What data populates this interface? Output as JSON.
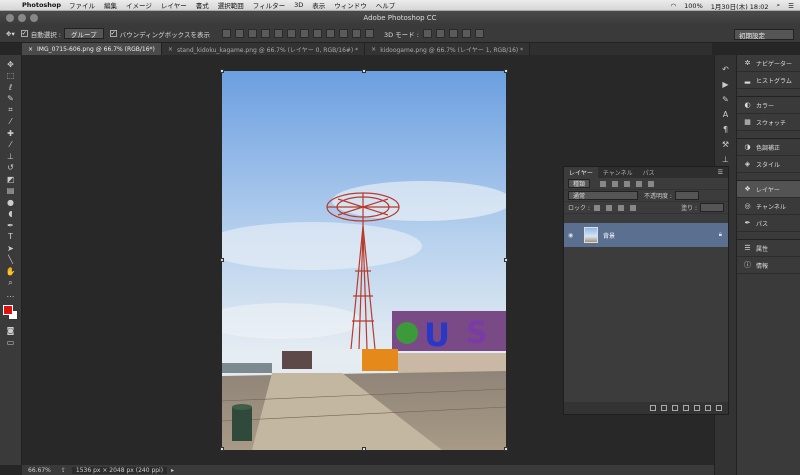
{
  "menubar": {
    "app_name": "Photoshop",
    "items": [
      "ファイル",
      "編集",
      "イメージ",
      "レイヤー",
      "書式",
      "選択範囲",
      "フィルター",
      "3D",
      "表示",
      "ウィンドウ",
      "ヘルプ"
    ],
    "battery": "100%",
    "datetime": "1月30日(木) 18:02"
  },
  "window": {
    "title": "Adobe Photoshop CC"
  },
  "options": {
    "auto_select_label": "自動選択 :",
    "auto_select_value": "グループ",
    "bbox_label": "バウンディングボックスを表示",
    "mode_3d": "3D モード :",
    "workspace": "初期設定"
  },
  "tabs": [
    {
      "label": "IMG_0715-606.png @ 66.7% (RGB/16*)",
      "active": true
    },
    {
      "label": "stand_kidoku_kagame.png @ 66.7% (レイヤー 0, RGB/16#) *",
      "active": false
    },
    {
      "label": "kidoogame.png @ 66.7% (レイヤー 1, RGB/16) *",
      "active": false
    }
  ],
  "status": {
    "zoom": "66.67%",
    "info": "1536 px × 2048 px (240 ppi)"
  },
  "right_panels": [
    {
      "label": "ナビゲーター",
      "icon": "navigator-icon"
    },
    {
      "label": "ヒストグラム",
      "icon": "histogram-icon"
    },
    {
      "label": "カラー",
      "icon": "color-icon"
    },
    {
      "label": "スウォッチ",
      "icon": "swatches-icon"
    },
    {
      "label": "色調補正",
      "icon": "adjustments-icon"
    },
    {
      "label": "スタイル",
      "icon": "styles-icon"
    },
    {
      "label": "レイヤー",
      "icon": "layers-icon",
      "active": true
    },
    {
      "label": "チャンネル",
      "icon": "channels-icon"
    },
    {
      "label": "パス",
      "icon": "paths-icon"
    },
    {
      "label": "属性",
      "icon": "properties-icon"
    },
    {
      "label": "情報",
      "icon": "info-icon"
    }
  ],
  "layers_panel": {
    "tabs": [
      "レイヤー",
      "チャンネル",
      "パス"
    ],
    "kind": "種類",
    "blend": "通常",
    "opacity_label": "不透明度 :",
    "lock_label": "ロック :",
    "fill_label": "塗り :",
    "layer_name": "背景"
  },
  "photo_sign_letters": [
    "U",
    "S"
  ],
  "colors": {
    "foreground": "#e01010",
    "background": "#ffffff",
    "selected_layer": "#5b6f91"
  }
}
